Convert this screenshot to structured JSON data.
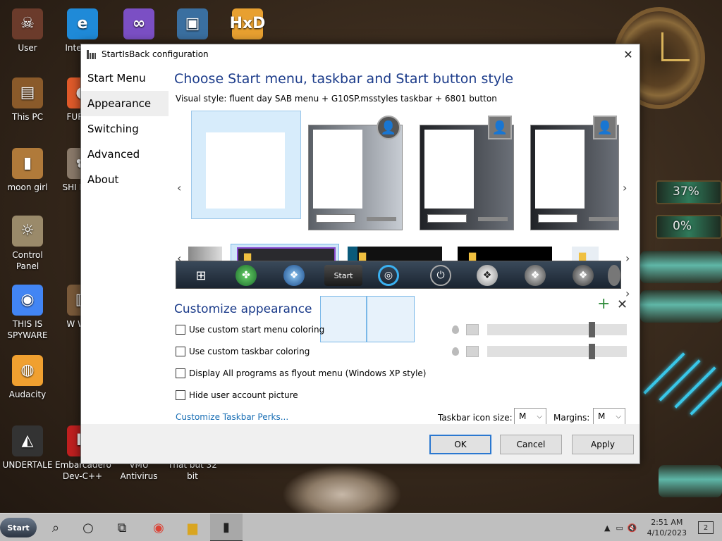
{
  "desktop": {
    "icons": [
      {
        "label": "User",
        "glyph": "☠",
        "color": "#6b3b2b"
      },
      {
        "label": "Inte Exp",
        "glyph": "e",
        "color": "#1f8ad8"
      },
      {
        "label": "",
        "glyph": "∞",
        "color": "#7b4fc4"
      },
      {
        "label": "",
        "glyph": "▣",
        "color": "#3a6fa0"
      },
      {
        "label": "",
        "glyph": "HxD",
        "color": "#e8a030"
      },
      {
        "label": "This PC",
        "glyph": "▤",
        "color": "#8a5a2a"
      },
      {
        "label": "FURR U",
        "glyph": "◐",
        "color": "#e05a2a"
      },
      {
        "label": "moon girl",
        "glyph": "▮",
        "color": "#b07a3a"
      },
      {
        "label": "SHI PHOT",
        "glyph": "✿",
        "color": "#8a7a6a"
      },
      {
        "label": "Control Panel",
        "glyph": "☼",
        "color": "#9a8a6a"
      },
      {
        "label": "THIS IS SPYWARE",
        "glyph": "◉",
        "color": "#4285f4"
      },
      {
        "label": "W Wres",
        "glyph": "▥",
        "color": "#7a5a3a"
      },
      {
        "label": "Audacity",
        "glyph": "◍",
        "color": "#f0a030"
      },
      {
        "label": "UNDERTALE",
        "glyph": "◭",
        "color": "#333333"
      },
      {
        "label": "Embarcadero Dev-C++",
        "glyph": "D",
        "color": "#c02020"
      },
      {
        "label": "VMU Antivirus",
        "glyph": "",
        "color": "transparent"
      },
      {
        "label": "That but 32 bit",
        "glyph": "",
        "color": "transparent"
      }
    ],
    "gauge1": "37%",
    "gauge2": "0%"
  },
  "window": {
    "title": "StartIsBack configuration",
    "close_glyph": "✕",
    "nav": [
      "Start Menu",
      "Appearance",
      "Switching",
      "Advanced",
      "About"
    ],
    "active_nav": 1,
    "heading": "Choose Start menu, taskbar and Start button style",
    "visual_style": "Visual style:  fluent day SAB menu + G10SP.msstyles taskbar + 6801 button",
    "prev_arrow": "‹",
    "next_arrow": "›",
    "customize_heading": "Customize appearance",
    "plus_glyph": "+",
    "x_glyph": "✕",
    "checkboxes": [
      "Use custom start menu coloring",
      "Use custom taskbar coloring",
      "Display All programs as flyout menu (Windows XP style)",
      "Hide user account picture"
    ],
    "slider1": 0.76,
    "slider2": 0.76,
    "link": "Customize Taskbar Perks...",
    "icon_size_label": "Taskbar icon size:",
    "icon_size_value": "M",
    "margins_label": "Margins:",
    "margins_value": "M",
    "ok": "OK",
    "cancel": "Cancel",
    "apply": "Apply",
    "start_button_text": "Start"
  },
  "taskbar": {
    "start": "Start",
    "time": "2:51 AM",
    "date": "4/10/2023",
    "notifications": "2"
  },
  "colors": {
    "accent": "#1b3b8a",
    "link": "#1a6fb5",
    "selection": "#7ab8e8"
  }
}
